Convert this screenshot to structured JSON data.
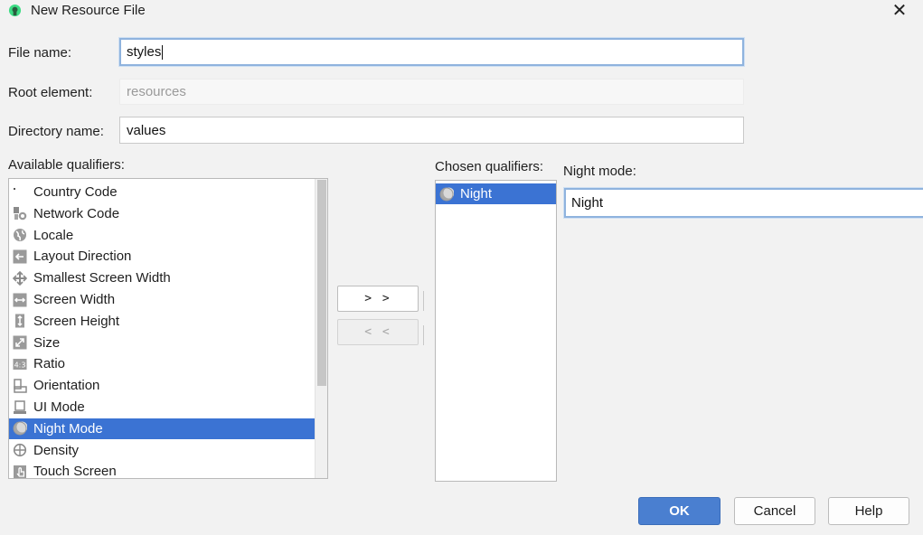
{
  "window": {
    "title": "New Resource File",
    "close_glyph": "✕"
  },
  "form": {
    "file_name_label": "File name:",
    "file_name_value": "styles",
    "root_element_label": "Root element:",
    "root_element_placeholder": "resources",
    "directory_name_label": "Directory name:",
    "directory_name_value": "values"
  },
  "available": {
    "label": "Available qualifiers:",
    "items": [
      {
        "label": "Country Code",
        "icon": "dot-icon"
      },
      {
        "label": "Network Code",
        "icon": "network-code-icon"
      },
      {
        "label": "Locale",
        "icon": "globe-icon"
      },
      {
        "label": "Layout Direction",
        "icon": "layout-direction-icon"
      },
      {
        "label": "Smallest Screen Width",
        "icon": "smallest-width-icon"
      },
      {
        "label": "Screen Width",
        "icon": "screen-width-icon"
      },
      {
        "label": "Screen Height",
        "icon": "screen-height-icon"
      },
      {
        "label": "Size",
        "icon": "size-icon"
      },
      {
        "label": "Ratio",
        "icon": "ratio-icon"
      },
      {
        "label": "Orientation",
        "icon": "orientation-icon"
      },
      {
        "label": "UI Mode",
        "icon": "ui-mode-icon"
      },
      {
        "label": "Night Mode",
        "icon": "night-mode-icon",
        "selected": true
      },
      {
        "label": "Density",
        "icon": "density-icon"
      },
      {
        "label": "Touch Screen",
        "icon": "touch-screen-icon"
      }
    ]
  },
  "move": {
    "add_label": "> >",
    "remove_label": "< <"
  },
  "chosen": {
    "label": "Chosen qualifiers:",
    "items": [
      {
        "label": "Night",
        "icon": "night-mode-icon",
        "selected": true
      }
    ]
  },
  "detail": {
    "label": "Night mode:",
    "value": "Night"
  },
  "buttons": {
    "ok": "OK",
    "cancel": "Cancel",
    "help": "Help"
  },
  "colors": {
    "selection": "#3b73d3",
    "primary_button": "#4a7fd0",
    "focus_border": "#8fb3de"
  }
}
